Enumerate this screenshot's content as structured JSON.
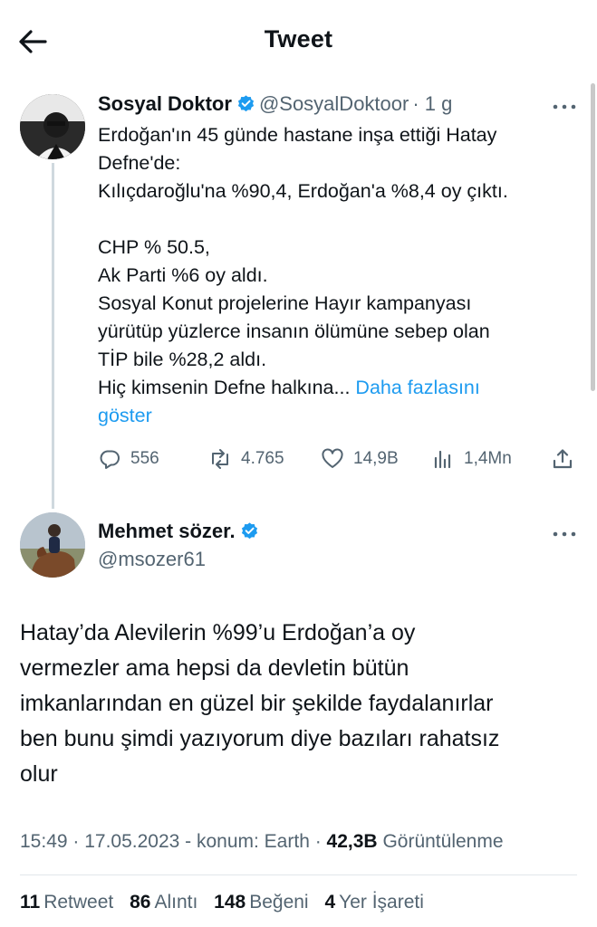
{
  "header": {
    "title": "Tweet"
  },
  "colors": {
    "accent": "#1d9bf0",
    "muted": "#536471",
    "text": "#0f1419"
  },
  "quoted_tweet": {
    "name": "Sosyal Doktor",
    "handle": "@SosyalDoktoor",
    "time": "· 1 g",
    "body_lines": [
      "Erdoğan'ın 45 günde hastane inşa ettiği Hatay",
      "Defne'de:",
      "Kılıçdaroğlu'na %90,4, Erdoğan'a %8,4 oy çıktı.",
      "",
      "CHP % 50.5,",
      "Ak Parti %6 oy aldı.",
      "Sosyal Konut projelerine Hayır kampanyası",
      "yürütüp yüzlerce insanın ölümüne sebep olan",
      "TİP bile %28,2 aldı.",
      "Hiç kimsenin Defne halkına..."
    ],
    "show_more_part1": "Daha fazlasını",
    "show_more_part2": "göster",
    "actions": {
      "replies": "556",
      "retweets": "4.765",
      "likes": "14,9B",
      "views": "1,4Mn"
    }
  },
  "main_tweet": {
    "name": "Mehmet sözer.",
    "handle": "@msozer61",
    "body_lines": [
      "Hatay’da Alevilerin %99’u Erdoğan’a oy",
      "vermezler ama hepsi da devletin bütün",
      "imkanlarından en güzel bir şekilde faydalanırlar",
      "ben bunu şimdi yazıyorum diye bazıları rahatsız",
      "olur"
    ],
    "meta_prefix": "15:49 · 17.05.2023 - konum: Earth ·",
    "views_count": "42,3B",
    "views_label": "Görüntülenme",
    "stats": [
      {
        "count": "11",
        "label": "Retweet"
      },
      {
        "count": "86",
        "label": "Alıntı"
      },
      {
        "count": "148",
        "label": "Beğeni"
      },
      {
        "count": "4",
        "label": "Yer İşareti"
      }
    ]
  }
}
